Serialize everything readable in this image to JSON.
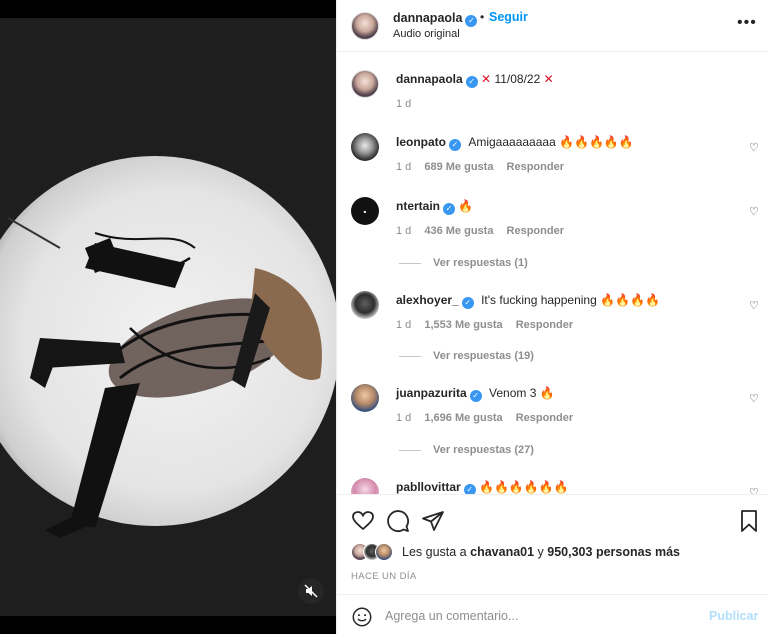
{
  "post": {
    "author": "dannapaola",
    "follow_label": "Seguir",
    "dot": "•",
    "audio": "Audio original",
    "more_icon": "more-horizontal-icon"
  },
  "caption": {
    "user": "dannapaola",
    "text": "11/08/22",
    "time": "1 d"
  },
  "comments": [
    {
      "user": "leonpato",
      "text": "Amigaaaaaaaaa",
      "emoji": "🔥🔥🔥🔥🔥",
      "time": "1 d",
      "likes": "689 Me gusta",
      "reply": "Responder"
    },
    {
      "user": "ntertain",
      "text": "",
      "emoji": "🔥",
      "time": "1 d",
      "likes": "436 Me gusta",
      "reply": "Responder",
      "replies": "Ver respuestas (1)"
    },
    {
      "user": "alexhoyer_",
      "text": "It's fucking happening",
      "emoji": "🔥🔥🔥🔥",
      "time": "1 d",
      "likes": "1,553 Me gusta",
      "reply": "Responder",
      "replies": "Ver respuestas (19)"
    },
    {
      "user": "juanpazurita",
      "text": "Venom 3",
      "emoji": "🔥",
      "time": "1 d",
      "likes": "1,696 Me gusta",
      "reply": "Responder",
      "replies": "Ver respuestas (27)"
    },
    {
      "user": "pabllovittar",
      "text": "",
      "emoji": "🔥🔥🔥🔥🔥🔥"
    }
  ],
  "likes": {
    "prefix": "Les gusta a",
    "user": "chavana01",
    "middle": "y",
    "count": "950,303 personas más"
  },
  "time_ago": "HACE UN DÍA",
  "composer": {
    "placeholder": "Agrega un comentario...",
    "post_label": "Publicar"
  },
  "colors": {
    "accent": "#0095f6",
    "verified": "#3897f0",
    "muted": "#8e8e8e",
    "publish_disabled": "#b2dffc"
  }
}
